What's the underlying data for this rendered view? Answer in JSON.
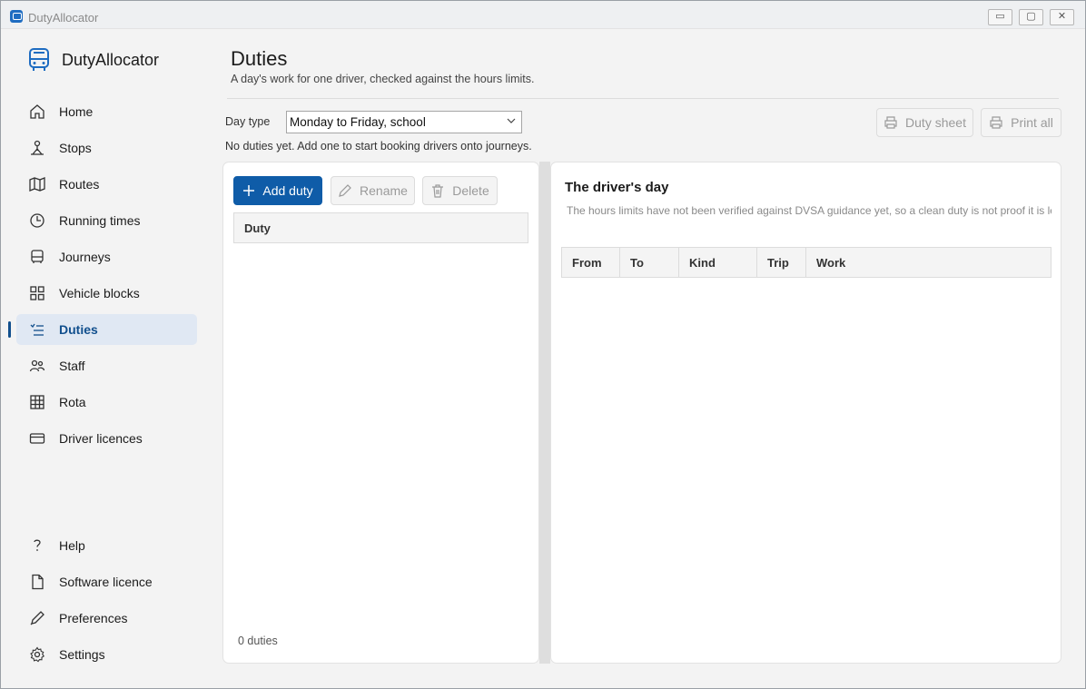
{
  "window": {
    "title": "DutyAllocator"
  },
  "titlebar_buttons": {
    "minimize": "▭",
    "maximize": "▢",
    "close": "✕"
  },
  "brand": {
    "name": "DutyAllocator",
    "icon": "bus-icon"
  },
  "sidebar": {
    "items": [
      {
        "label": "Home",
        "icon": "home-icon"
      },
      {
        "label": "Stops",
        "icon": "stop-icon"
      },
      {
        "label": "Routes",
        "icon": "map-icon"
      },
      {
        "label": "Running times",
        "icon": "clock-icon"
      },
      {
        "label": "Journeys",
        "icon": "bus-icon"
      },
      {
        "label": "Vehicle blocks",
        "icon": "grid-icon"
      },
      {
        "label": "Duties",
        "icon": "list-icon",
        "active": true
      },
      {
        "label": "Staff",
        "icon": "people-icon"
      },
      {
        "label": "Rota",
        "icon": "table-icon"
      },
      {
        "label": "Driver licences",
        "icon": "card-icon"
      }
    ],
    "footer_items": [
      {
        "label": "Help",
        "icon": "question-icon"
      },
      {
        "label": "Software licence",
        "icon": "document-icon"
      },
      {
        "label": "Preferences",
        "icon": "pen-icon"
      },
      {
        "label": "Settings",
        "icon": "gear-icon"
      }
    ]
  },
  "page": {
    "title": "Duties",
    "subtitle": "A day's work for one driver, checked against the hours limits.",
    "day_type_label": "Day type",
    "day_type_value": "Monday to Friday, school",
    "empty_message": "No duties yet. Add one to start booking drivers onto journeys.",
    "duty_sheet_label": "Duty sheet",
    "print_all_label": "Print all"
  },
  "duties_panel": {
    "add_label": "Add duty",
    "rename_label": "Rename",
    "delete_label": "Delete",
    "column_header": "Duty",
    "count_text": "0 duties"
  },
  "day_panel": {
    "title": "The driver's day",
    "note": "The hours limits have not been verified against DVSA guidance yet, so a clean duty is not proof it is leg",
    "columns": [
      "From",
      "To",
      "Kind",
      "Trip",
      "Work"
    ]
  },
  "colors": {
    "accent": "#0f5ca8",
    "active_bg": "#e0e8f3",
    "active_text": "#114f8d"
  }
}
